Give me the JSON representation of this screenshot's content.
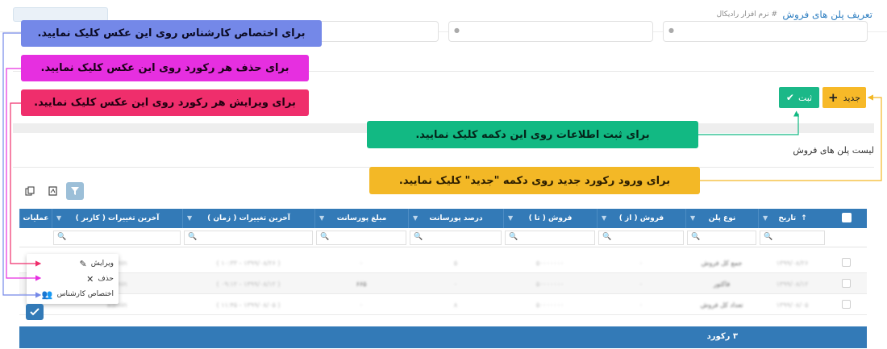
{
  "header": {
    "title": "تعریف پلن های فروش",
    "subtitle": "# نرم افزار رادیکال"
  },
  "actions": {
    "new_label": "جدید",
    "save_label": "ثبت"
  },
  "list": {
    "title": "لیست پلن های فروش"
  },
  "grid": {
    "columns": [
      "تاریخ",
      "نوع پلن",
      "فروش ( از )",
      "فروش ( تا )",
      "درصد پورسانت",
      "مبلغ پورسانت",
      "آخرین تغییرات ( زمان )",
      "آخرین تغییرات ( کاربر )",
      "عملیات"
    ],
    "sort_indicator": "↑",
    "rows": [
      [
        "۱۳۹۹/۰۸/۲۶",
        "جمع کل فروش",
        "۰",
        "۵۰۰۰۰۰۰۰",
        "۵",
        "۰",
        "( ۱۳۹۹/۰۸/۲۶ - ۱۰:۳۳ )",
        "admin",
        ""
      ],
      [
        "۱۳۹۹/۰۸/۱۲",
        "فاکتور",
        "۰",
        "۵۰۰۰۰۰۰۰",
        "۰",
        "۶۶۵",
        "( ۱۳۹۹/۰۸/۱۲ - ۰۹:۱۲ )",
        "admin",
        ""
      ],
      [
        "۱۳۹۹/۰۸/۰۵",
        "تعداد کل فروش",
        "۰",
        "۵۰۰۰۰۰۰۰",
        "۸",
        "۰",
        "( ۱۳۹۹/۰۸/۰۵ - ۱۱:۴۵ )",
        "admin",
        ""
      ]
    ],
    "footer_count": "۳ رکورد"
  },
  "operations_menu": {
    "edit": "ویرایش",
    "delete": "حذف",
    "assign_expert": "اختصاص کارشناس"
  },
  "callouts": {
    "assign_expert": "برای اختصاص کارشناس روی این عکس کلیک نمایید.",
    "delete_record": "برای حذف هر رکورد روی این عکس کلیک نمایید.",
    "edit_record": "برای ویرایش هر رکورد روی این عکس کلیک نمایید.",
    "save_info": "برای ثبت اطلاعات روی این دکمه کلیک نمایید.",
    "new_record": "برای ورود رکورد جدید روی دکمه \"جدید\" کلیک نمایید."
  },
  "colors": {
    "primary": "#337ab7",
    "new_button": "#f7b928",
    "save_button": "#1bb888",
    "callout_assign": "#7488e8",
    "callout_delete": "#e62fe0",
    "callout_edit": "#ef2e6c",
    "callout_save": "#12b983",
    "callout_new": "#f3b826"
  },
  "icons": {
    "filter": "filter-icon",
    "search": "search-icon",
    "edit": "pencil-icon",
    "delete": "close-icon",
    "assign": "user-group-icon",
    "new": "plus-icon",
    "save": "check-icon"
  }
}
